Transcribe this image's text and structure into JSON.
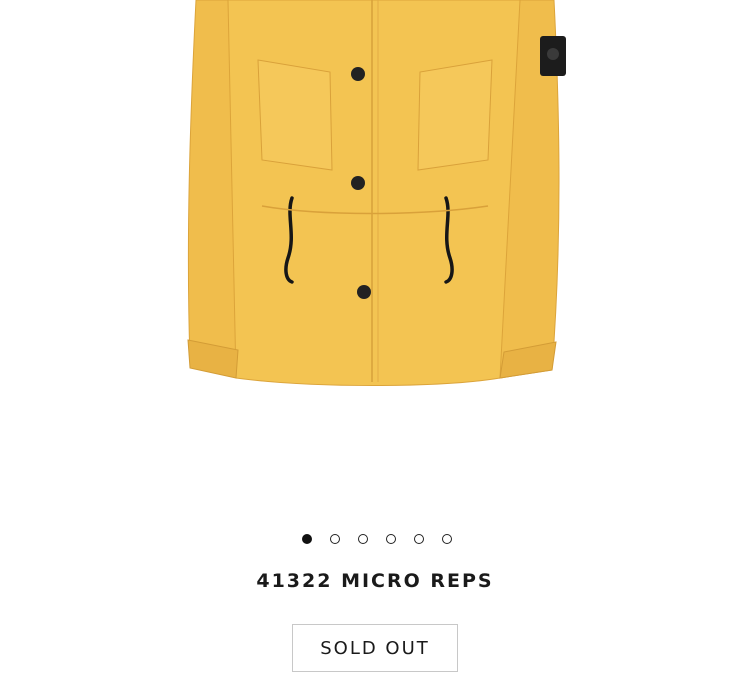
{
  "product": {
    "name": "41322 MICRO REPS",
    "status_label": "SOLD OUT",
    "color": "#f2c04e"
  },
  "carousel": {
    "total_slides": 6,
    "active_index": 1
  }
}
